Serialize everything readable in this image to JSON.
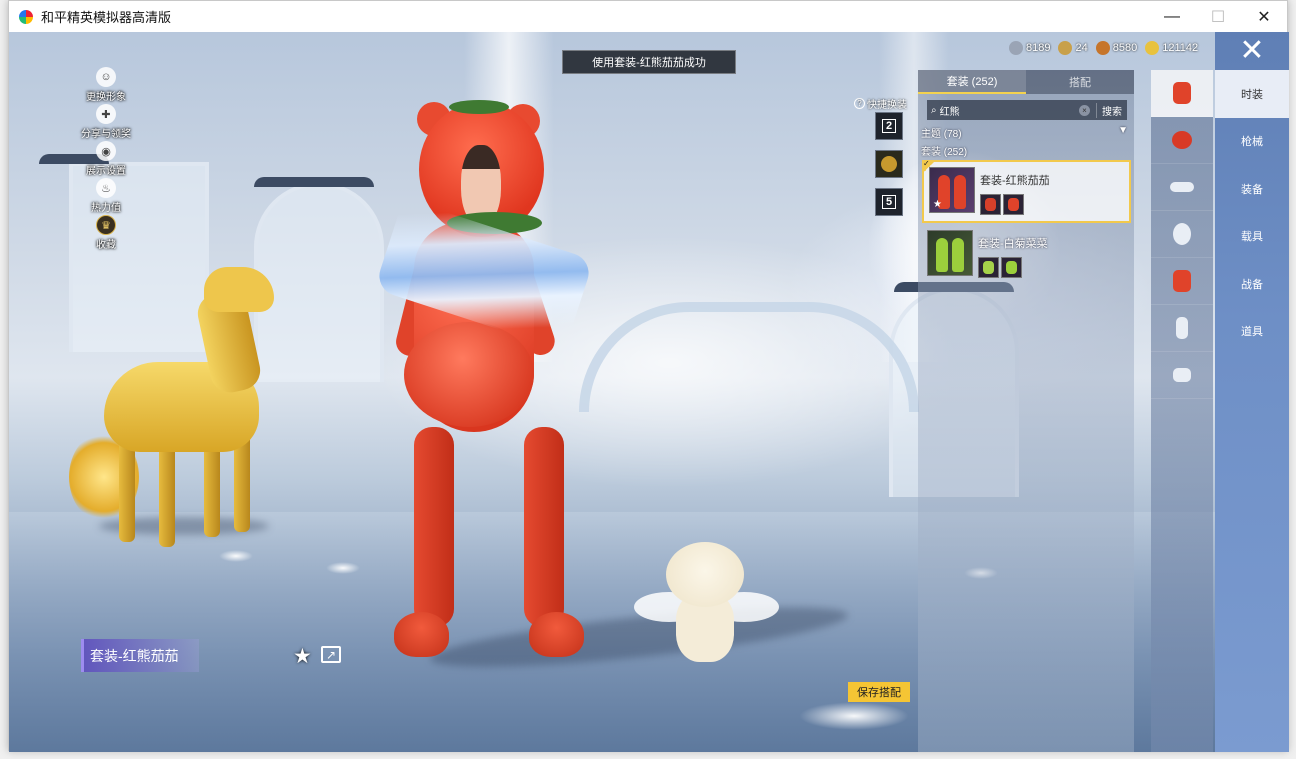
{
  "window": {
    "title": "和平精英模拟器高清版",
    "min": "—",
    "max": "☐",
    "close": "✕"
  },
  "toast": "使用套装-红熊茄茄成功",
  "left_menu": [
    {
      "label": "更换形象",
      "icon": "person-icon",
      "glyph": "☺"
    },
    {
      "label": "分享与领奖",
      "icon": "share-gift-icon",
      "glyph": "✚"
    },
    {
      "label": "展示设置",
      "icon": "eye-icon",
      "glyph": "◉"
    },
    {
      "label": "热力值",
      "icon": "flame-icon",
      "glyph": "♨"
    },
    {
      "label": "收藏",
      "icon": "collection-icon",
      "glyph": "♛"
    }
  ],
  "currencies": [
    {
      "value": "8189",
      "icon": "coin-silver-icon",
      "color": "#9aa4b5"
    },
    {
      "value": "24",
      "icon": "coin-a-icon",
      "color": "#c8a04a"
    },
    {
      "value": "8580",
      "icon": "coin-bronze-icon",
      "color": "#c6752b"
    },
    {
      "value": "121142",
      "icon": "coin-gold-icon",
      "color": "#e8c23e"
    }
  ],
  "quick_change": {
    "label": "快捷换装",
    "help": "?",
    "slots": [
      "2",
      "",
      "5"
    ]
  },
  "panel": {
    "tabs": [
      "套装 (252)",
      "搭配"
    ],
    "search": {
      "value": "红熊",
      "button": "搜索",
      "clear": "×"
    },
    "filter": {
      "label": "主题 (78)",
      "arrow": "▼"
    },
    "group_title": "套装 (252)",
    "cards": [
      {
        "name": "套装-红熊茄茄",
        "selected": true,
        "star": "★",
        "check": "✓",
        "color": "#e0432a"
      },
      {
        "name": "套装-白菊菜菜",
        "selected": false,
        "color": "#9ccf3c"
      }
    ]
  },
  "categories": [
    {
      "icon": "outfit-icon",
      "color": "#e0432a"
    },
    {
      "icon": "tomato-icon",
      "color": "#d83a26"
    },
    {
      "icon": "goggles-icon",
      "color": "#e9eef5"
    },
    {
      "icon": "face-icon",
      "color": "#e9eef5"
    },
    {
      "icon": "top-icon",
      "color": "#e0432a"
    },
    {
      "icon": "pants-icon",
      "color": "#e9eef5"
    },
    {
      "icon": "shoes-icon",
      "color": "#e9eef5"
    }
  ],
  "right_nav": {
    "close": "✕",
    "items": [
      "时装",
      "枪械",
      "装备",
      "载具",
      "战备",
      "道具"
    ]
  },
  "bottom": {
    "outfit_name": "套装-红熊茄茄",
    "star": "★",
    "share": "↗",
    "save": "保存搭配"
  },
  "colors": {
    "accent_yellow": "#f5c534",
    "nav_blue": "#6e8fc6",
    "selected_border": "#f2c94c"
  }
}
